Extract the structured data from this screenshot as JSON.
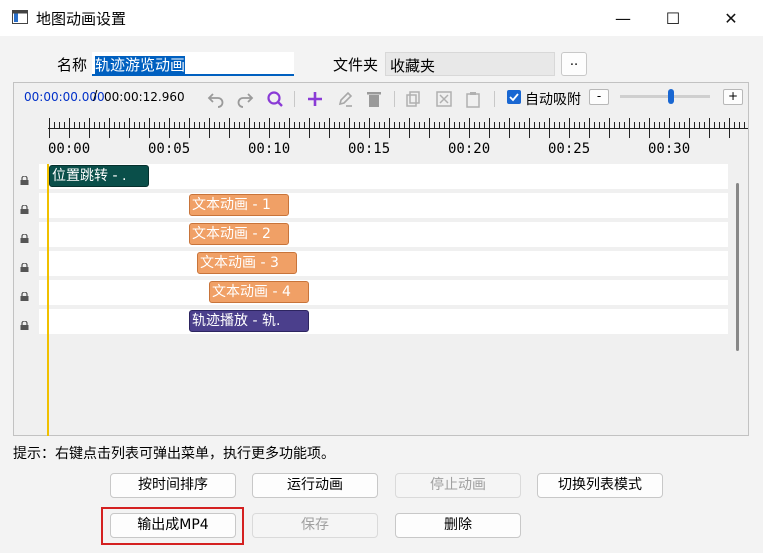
{
  "window": {
    "title": "地图动画设置",
    "minimize_glyph": "—",
    "maximize_glyph": "☐",
    "close_glyph": "✕"
  },
  "form": {
    "name_label": "名称",
    "name_value": "轨迹游览动画",
    "folder_label": "文件夹",
    "folder_value": "收藏夹",
    "browse_label": ".."
  },
  "toolbar": {
    "current_time": "00:00:00.000",
    "separator": "/",
    "total_time": "00:00:12.960",
    "snap_label": "自动吸附",
    "snap_checked": true,
    "zoom_out_label": "-",
    "zoom_in_label": "+",
    "zoom_level": 0.55,
    "icons": [
      "undo-icon",
      "redo-icon",
      "search-icon",
      "add-icon",
      "edit-icon",
      "delete-icon",
      "copy-icon",
      "cut-icon",
      "paste-icon"
    ]
  },
  "ruler": {
    "labels": [
      "00:00",
      "00:05",
      "00:10",
      "00:15",
      "00:20",
      "00:25",
      "00:30"
    ]
  },
  "tracks": [
    {
      "clip": "位置跳转 - .",
      "style": "dark",
      "start_s": 0.0,
      "end_s": 5.0
    },
    {
      "clip": "文本动画 - 1",
      "style": "orange",
      "start_s": 7.0,
      "end_s": 12.0
    },
    {
      "clip": "文本动画 - 2",
      "style": "orange",
      "start_s": 7.0,
      "end_s": 12.0
    },
    {
      "clip": "文本动画 - 3",
      "style": "orange",
      "start_s": 7.4,
      "end_s": 12.4
    },
    {
      "clip": "文本动画 - 4",
      "style": "orange",
      "start_s": 8.0,
      "end_s": 13.0
    },
    {
      "clip": "轨迹播放 - 轨.",
      "style": "purple",
      "start_s": 7.0,
      "end_s": 13.0
    }
  ],
  "hint": "提示：右键点击列表可弹出菜单，执行更多功能项。",
  "buttons": {
    "sort_by_time": "按时间排序",
    "run_animation": "运行动画",
    "stop_animation": "停止动画",
    "toggle_list_mode": "切换列表模式",
    "export_mp4": "输出成MP4",
    "save": "保存",
    "delete": "删除"
  },
  "colors": {
    "accent": "#1967d2",
    "highlight": "#d42020",
    "playhead": "#f0c000"
  }
}
